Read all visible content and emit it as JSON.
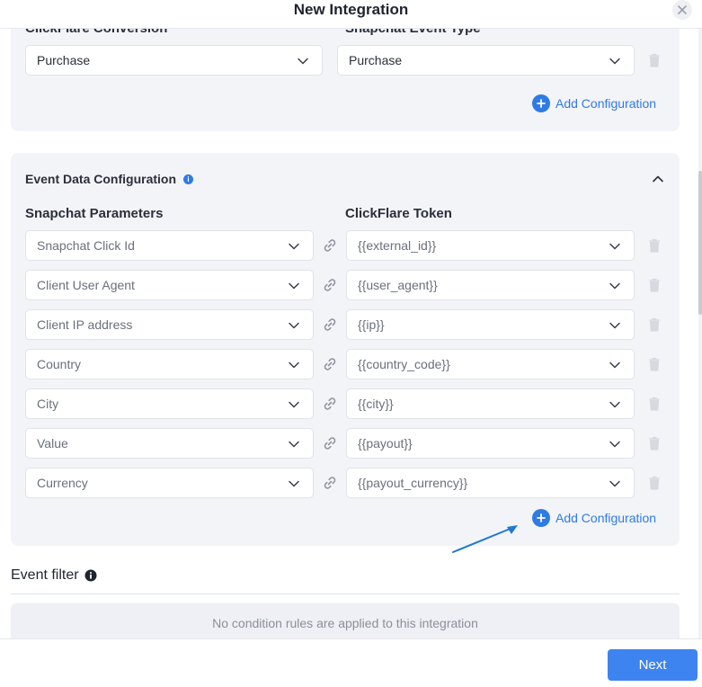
{
  "modal": {
    "title": "New Integration"
  },
  "conversion": {
    "clickflare_label": "ClickFlare Conversion",
    "snapchat_label": "Snapchat Event Type",
    "clickflare_value": "Purchase",
    "snapchat_value": "Purchase",
    "add_label": "Add Configuration"
  },
  "event_data": {
    "title": "Event Data Configuration",
    "params_label": "Snapchat Parameters",
    "token_label": "ClickFlare Token",
    "rows": [
      {
        "param": "Snapchat Click Id",
        "token": "{{external_id}}"
      },
      {
        "param": "Client User Agent",
        "token": "{{user_agent}}"
      },
      {
        "param": "Client IP address",
        "token": "{{ip}}"
      },
      {
        "param": "Country",
        "token": "{{country_code}}"
      },
      {
        "param": "City",
        "token": "{{city}}"
      },
      {
        "param": "Value",
        "token": "{{payout}}"
      },
      {
        "param": "Currency",
        "token": "{{payout_currency}}"
      }
    ],
    "add_label": "Add Configuration"
  },
  "event_filter": {
    "title": "Event filter",
    "empty_text": "No condition rules are applied to this integration"
  },
  "footer": {
    "next_label": "Next"
  },
  "colors": {
    "accent": "#2f7be6",
    "card_bg": "#f3f4f8",
    "next_bg": "#3d84f0"
  }
}
